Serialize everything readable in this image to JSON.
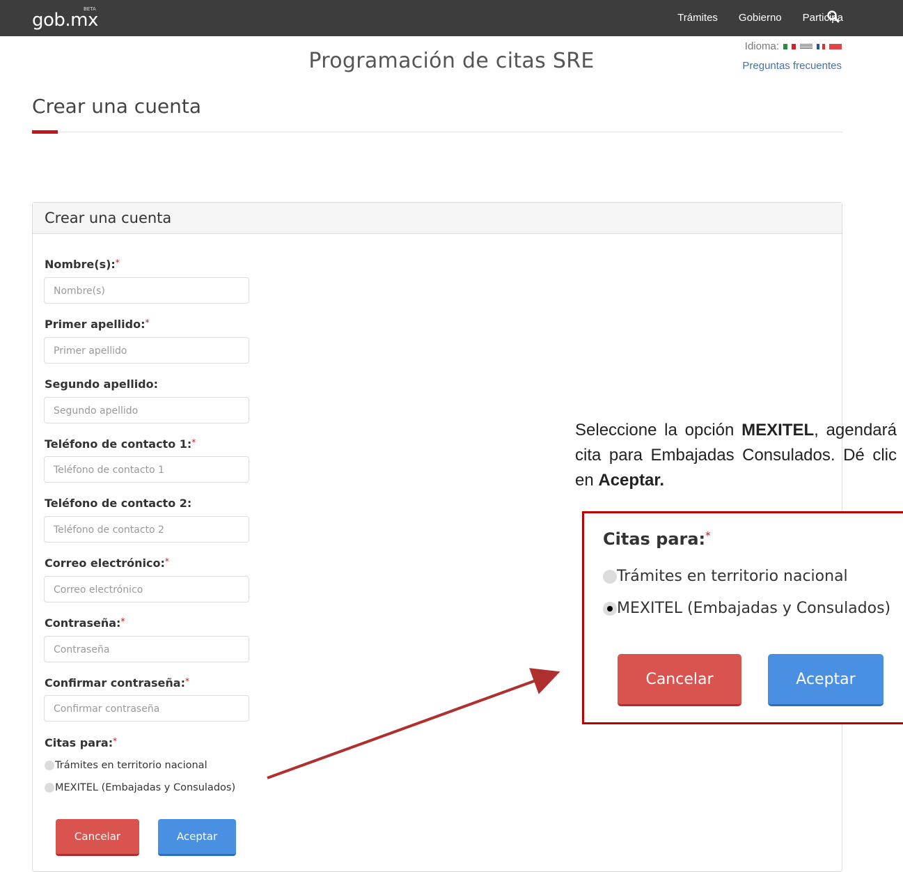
{
  "header": {
    "brand": "gob.mx",
    "brand_badge": "BETA",
    "nav": [
      "Trámites",
      "Gobierno",
      "Participa"
    ]
  },
  "page": {
    "title": "Programación de citas SRE",
    "language_label": "Idioma:",
    "faq_link": "Preguntas frecuentes",
    "section_title": "Crear una cuenta"
  },
  "form": {
    "heading": "Crear una cuenta",
    "fields": [
      {
        "label": "Nombre(s):",
        "required": true,
        "placeholder": "Nombre(s)"
      },
      {
        "label": "Primer apellido:",
        "required": true,
        "placeholder": "Primer apellido"
      },
      {
        "label": "Segundo apellido:",
        "required": false,
        "placeholder": "Segundo apellido"
      },
      {
        "label": "Teléfono de contacto 1:",
        "required": true,
        "placeholder": "Teléfono de contacto 1"
      },
      {
        "label": "Teléfono de contacto 2:",
        "required": false,
        "placeholder": "Teléfono de contacto 2"
      },
      {
        "label": "Correo electrónico:",
        "required": true,
        "placeholder": "Correo electrónico"
      },
      {
        "label": "Contraseña:",
        "required": true,
        "placeholder": "Contraseña"
      },
      {
        "label": "Confirmar contraseña:",
        "required": true,
        "placeholder": "Confirmar contraseña"
      }
    ],
    "citas_label": "Citas para:",
    "required_mark": "*",
    "options": [
      "Trámites en territorio nacional",
      "MEXITEL (Embajadas y Consulados)"
    ],
    "cancel_label": "Cancelar",
    "accept_label": "Aceptar"
  },
  "annotation": {
    "text_1": "Seleccione la opción ",
    "text_bold_1": "MEXITEL",
    "text_2": ", agendará cita para Embajadas Consulados. Dé clic en ",
    "text_bold_2": "Aceptar.",
    "zoom_citas_label": "Citas para:",
    "zoom_options": [
      "Trámites en territorio nacional",
      "MEXITEL (Embajadas y Consulados)"
    ],
    "zoom_selected_index": 1,
    "zoom_cancel": "Cancelar",
    "zoom_accept": "Aceptar"
  },
  "colors": {
    "topbar": "#3d3d3d",
    "accent_red": "#c4161c",
    "cancel_red": "#d9534f",
    "accept_blue": "#4a90e2",
    "highlight_border": "#c00000",
    "arrow": "#b03030"
  }
}
